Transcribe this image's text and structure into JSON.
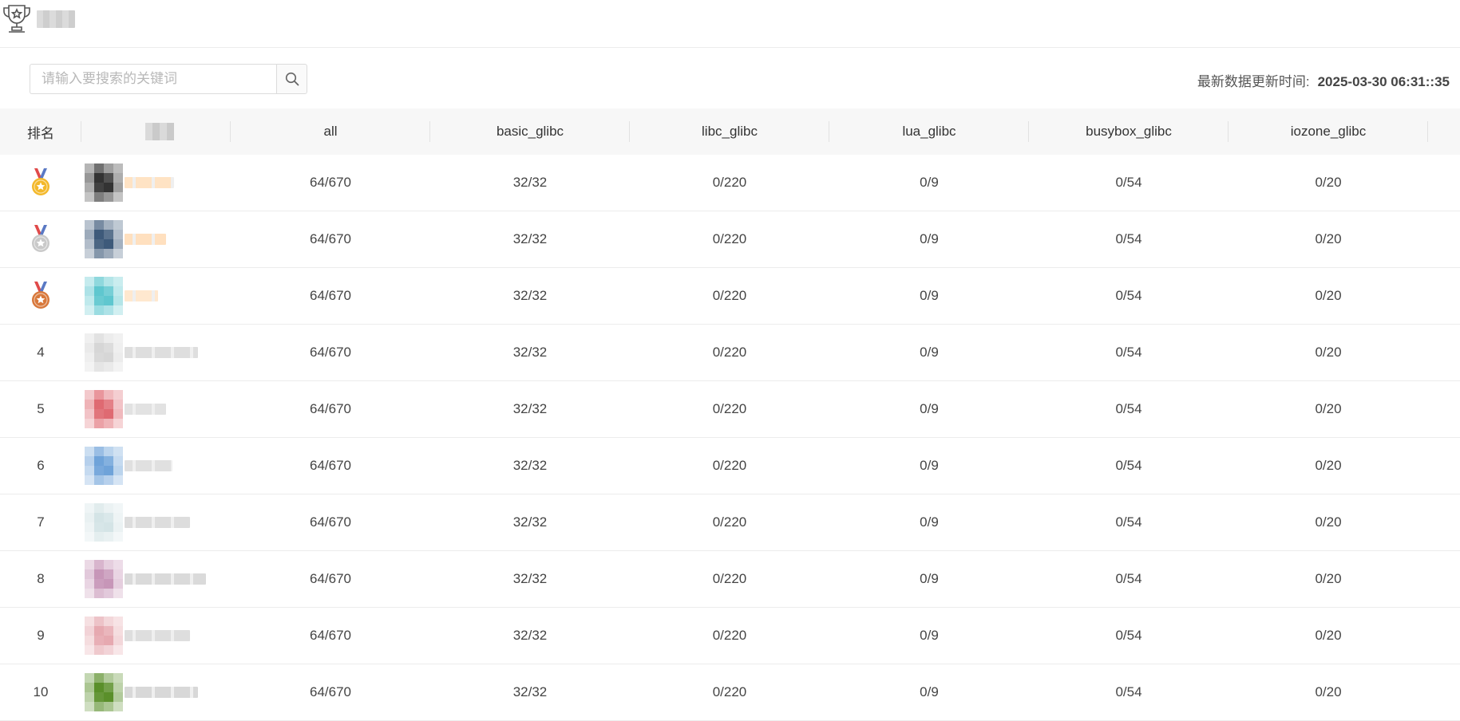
{
  "page_title": "排行榜",
  "search": {
    "placeholder": "请输入要搜索的关键词",
    "value": ""
  },
  "update": {
    "label": "最新数据更新时间:",
    "timestamp": "2025-03-30 06:31::35"
  },
  "table": {
    "columns": [
      "排名",
      "队伍",
      "all",
      "basic_glibc",
      "libc_glibc",
      "lua_glibc",
      "busybox_glibc",
      "iozone_glibc"
    ],
    "rows": [
      {
        "rank": "1",
        "medal": "gold-medal-icon",
        "all": "64/670",
        "basic_glibc": "32/32",
        "libc_glibc": "0/220",
        "lua_glibc": "0/9",
        "busybox_glibc": "0/54",
        "iozone_glibc": "0/20"
      },
      {
        "rank": "2",
        "medal": "silver-medal-icon",
        "all": "64/670",
        "basic_glibc": "32/32",
        "libc_glibc": "0/220",
        "lua_glibc": "0/9",
        "busybox_glibc": "0/54",
        "iozone_glibc": "0/20"
      },
      {
        "rank": "3",
        "medal": "bronze-medal-icon",
        "all": "64/670",
        "basic_glibc": "32/32",
        "libc_glibc": "0/220",
        "lua_glibc": "0/9",
        "busybox_glibc": "0/54",
        "iozone_glibc": "0/20"
      },
      {
        "rank": "4",
        "all": "64/670",
        "basic_glibc": "32/32",
        "libc_glibc": "0/220",
        "lua_glibc": "0/9",
        "busybox_glibc": "0/54",
        "iozone_glibc": "0/20"
      },
      {
        "rank": "5",
        "all": "64/670",
        "basic_glibc": "32/32",
        "libc_glibc": "0/220",
        "lua_glibc": "0/9",
        "busybox_glibc": "0/54",
        "iozone_glibc": "0/20"
      },
      {
        "rank": "6",
        "all": "64/670",
        "basic_glibc": "32/32",
        "libc_glibc": "0/220",
        "lua_glibc": "0/9",
        "busybox_glibc": "0/54",
        "iozone_glibc": "0/20"
      },
      {
        "rank": "7",
        "all": "64/670",
        "basic_glibc": "32/32",
        "libc_glibc": "0/220",
        "lua_glibc": "0/9",
        "busybox_glibc": "0/54",
        "iozone_glibc": "0/20"
      },
      {
        "rank": "8",
        "all": "64/670",
        "basic_glibc": "32/32",
        "libc_glibc": "0/220",
        "lua_glibc": "0/9",
        "busybox_glibc": "0/54",
        "iozone_glibc": "0/20"
      },
      {
        "rank": "9",
        "all": "64/670",
        "basic_glibc": "32/32",
        "libc_glibc": "0/220",
        "lua_glibc": "0/9",
        "busybox_glibc": "0/54",
        "iozone_glibc": "0/20"
      },
      {
        "rank": "10",
        "all": "64/670",
        "basic_glibc": "32/32",
        "libc_glibc": "0/220",
        "lua_glibc": "0/9",
        "busybox_glibc": "0/54",
        "iozone_glibc": "0/20"
      }
    ]
  },
  "colors": {
    "gold": "#f3b82a",
    "silver": "#c9c9c9",
    "bronze": "#d8783b",
    "ribbon_red": "#e04a4a",
    "ribbon_blue": "#5a79c4",
    "avatars": [
      "#333333",
      "#3e5a7a",
      "#5fc7cf",
      "#d6d6d6",
      "#df6a72",
      "#6fa3d9",
      "#d4e4e6",
      "#c796b8",
      "#e6a9b0",
      "#5a8f2a"
    ],
    "name_blurs": [
      "#ffe3c4",
      "#ffe0bf",
      "#ffe8cf",
      "#dedede",
      "#e2e2e2",
      "#e0e0e0",
      "#dddddd",
      "#dadada",
      "#dedede",
      "#d8d8d8"
    ]
  }
}
